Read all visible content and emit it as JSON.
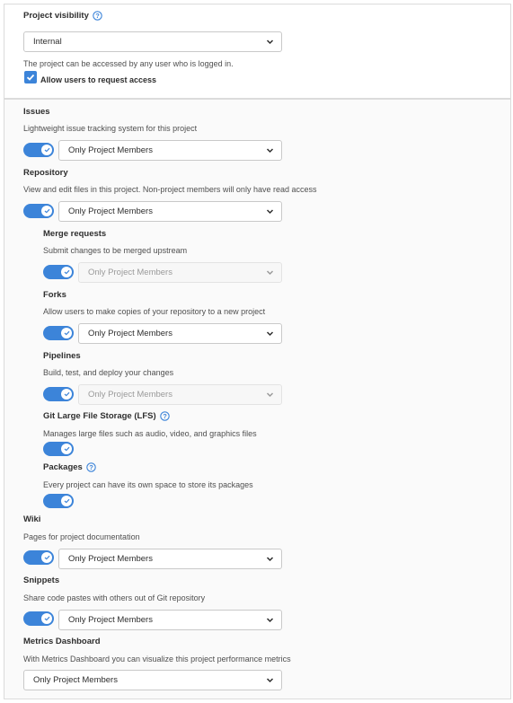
{
  "visibility": {
    "title": "Project visibility",
    "selected": "Internal",
    "description": "The project can be accessed by any user who is logged in.",
    "request_access_label": "Allow users to request access",
    "request_access_checked": true
  },
  "features": {
    "issues": {
      "title": "Issues",
      "description": "Lightweight issue tracking system for this project",
      "enabled": true,
      "access": "Only Project Members"
    },
    "repository": {
      "title": "Repository",
      "description": "View and edit files in this project. Non-project members will only have read access",
      "enabled": true,
      "access": "Only Project Members"
    },
    "merge_requests": {
      "title": "Merge requests",
      "description": "Submit changes to be merged upstream",
      "enabled": true,
      "access": "Only Project Members"
    },
    "forks": {
      "title": "Forks",
      "description": "Allow users to make copies of your repository to a new project",
      "enabled": true,
      "access": "Only Project Members"
    },
    "pipelines": {
      "title": "Pipelines",
      "description": "Build, test, and deploy your changes",
      "enabled": true,
      "access": "Only Project Members"
    },
    "lfs": {
      "title": "Git Large File Storage (LFS)",
      "description": "Manages large files such as audio, video, and graphics files",
      "enabled": true
    },
    "packages": {
      "title": "Packages",
      "description": "Every project can have its own space to store its packages",
      "enabled": true
    },
    "wiki": {
      "title": "Wiki",
      "description": "Pages for project documentation",
      "enabled": true,
      "access": "Only Project Members"
    },
    "snippets": {
      "title": "Snippets",
      "description": "Share code pastes with others out of Git repository",
      "enabled": true,
      "access": "Only Project Members"
    },
    "metrics": {
      "title": "Metrics Dashboard",
      "description": "With Metrics Dashboard you can visualize this project performance metrics",
      "access": "Only Project Members"
    }
  },
  "colors": {
    "accent": "#3c84d9",
    "panel_bg": "#fafafa",
    "border": "#dbdbdb"
  },
  "icons": {
    "help": "question-circle-icon",
    "chevron": "chevron-down-icon",
    "check": "check-icon"
  }
}
